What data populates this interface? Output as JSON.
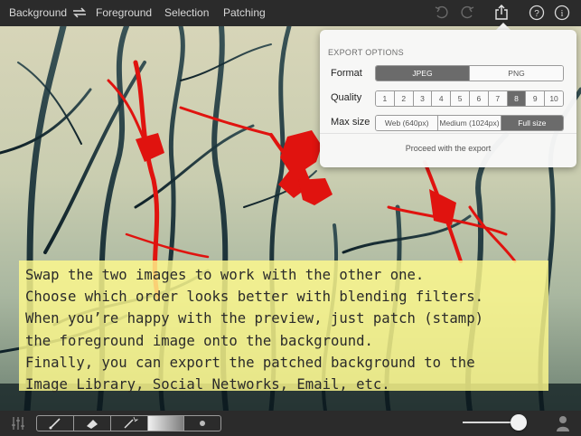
{
  "topbar": {
    "background_label": "Background",
    "foreground_label": "Foreground",
    "selection_label": "Selection",
    "patching_label": "Patching",
    "icons": [
      "swap-icon",
      "undo-icon",
      "redo-icon",
      "share-icon",
      "help-icon",
      "info-icon"
    ]
  },
  "export": {
    "title": "EXPORT OPTIONS",
    "format_label": "Format",
    "format_options": [
      "JPEG",
      "PNG"
    ],
    "format_selected": "JPEG",
    "quality_label": "Quality",
    "quality_options": [
      "1",
      "2",
      "3",
      "4",
      "5",
      "6",
      "7",
      "8",
      "9",
      "10"
    ],
    "quality_selected": "8",
    "maxsize_label": "Max size",
    "maxsize_options": [
      "Web (640px)",
      "Medium (1024px)",
      "Full size"
    ],
    "maxsize_selected": "Full size",
    "proceed_label": "Proceed with the export"
  },
  "instructions": {
    "lines": [
      "Swap the two images to work with the other one.",
      "Choose which order looks better with blending filters.",
      "When you’re happy with the preview, just patch (stamp)",
      "the foreground image onto the background.",
      "Finally, you can export the patched background to the",
      "Image Library, Social Networks, Email, etc."
    ]
  },
  "bottombar": {
    "tools": [
      "brush-icon",
      "eraser-icon",
      "magic-wand-icon",
      "gradient-icon",
      "soft-dot-icon"
    ],
    "selected_tool": "gradient-icon",
    "slider_level": 0.83,
    "icons": [
      "adjustments-icon",
      "person-icon"
    ]
  },
  "colors": {
    "toolbar_bg": "#2b2b2b",
    "highlight_red": "#e0130f",
    "note_yellow": "#fffa8c"
  }
}
